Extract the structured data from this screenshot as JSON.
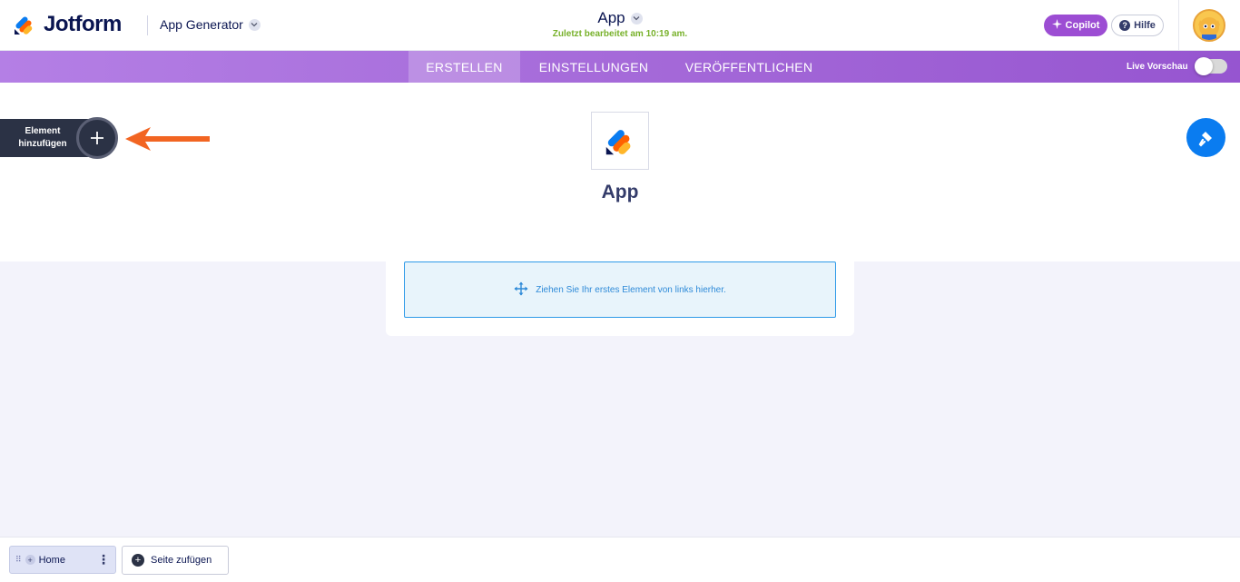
{
  "header": {
    "brand": "Jotform",
    "app_generator_label": "App Generator",
    "title": "App",
    "last_edited": "Zuletzt bearbeitet am 10:19 am.",
    "copilot_label": "Copilot",
    "help_label": "Hilfe"
  },
  "nav": {
    "tabs": [
      {
        "label": "ERSTELLEN",
        "active": true
      },
      {
        "label": "EINSTELLUNGEN",
        "active": false
      },
      {
        "label": "VERÖFFENTLICHEN",
        "active": false
      }
    ],
    "live_preview_label": "Live Vorschau",
    "live_preview_on": false
  },
  "builder": {
    "add_element_label": "Element hinzufügen",
    "app_name": "App",
    "dropzone_text": "Ziehen Sie Ihr erstes Element von links hierher."
  },
  "pages": {
    "items": [
      {
        "label": "Home",
        "active": true
      }
    ],
    "add_page_label": "Seite zufügen"
  },
  "colors": {
    "purple_nav": "#a56ad9",
    "copilot": "#9c4dd3",
    "accent_blue": "#0a7cf0",
    "arrow": "#f26522",
    "edited_green": "#78b12b"
  },
  "icons": [
    "jotform-logo-icon",
    "chevron-down-icon",
    "sparkle-icon",
    "help-icon",
    "avatar",
    "plus-icon",
    "arrow-left-icon",
    "paint-roller-icon",
    "move-icon",
    "drag-handle-icon",
    "more-vertical-icon"
  ]
}
